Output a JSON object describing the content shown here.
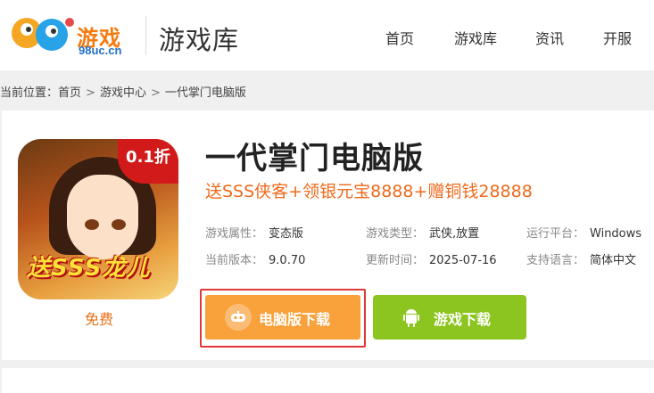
{
  "header": {
    "logo_text": "游戏",
    "logo_domain": "98uc.cn",
    "section_title": "游戏库",
    "nav": [
      "首页",
      "游戏库",
      "资讯",
      "开服"
    ]
  },
  "breadcrumb": {
    "label": "当前位置：",
    "items": [
      "首页",
      "游戏中心",
      "一代掌门电脑版"
    ],
    "separator": ">"
  },
  "game": {
    "badge": "0.1折",
    "banner": "送SSS龙儿",
    "price": "免费",
    "title": "一代掌门电脑版",
    "promo": "送SSS侠客+领银元宝8888+赠铜钱28888",
    "attrs": [
      {
        "k": "游戏属性：",
        "v": "变态版"
      },
      {
        "k": "游戏类型：",
        "v": "武侠,放置"
      },
      {
        "k": "运行平台：",
        "v": "Windows"
      },
      {
        "k": "当前版本：",
        "v": "9.0.70"
      },
      {
        "k": "更新时间：",
        "v": "2025-07-16"
      },
      {
        "k": "支持语言：",
        "v": "简体中文"
      }
    ]
  },
  "buttons": {
    "pc_download": "电脑版下载",
    "game_download": "游戏下载"
  },
  "colors": {
    "brand_orange": "#f57b10",
    "promo_orange": "#ef6a1c",
    "btn_pc": "#f9a13a",
    "btn_android": "#8cc51f",
    "highlight_border": "#e0383a"
  }
}
